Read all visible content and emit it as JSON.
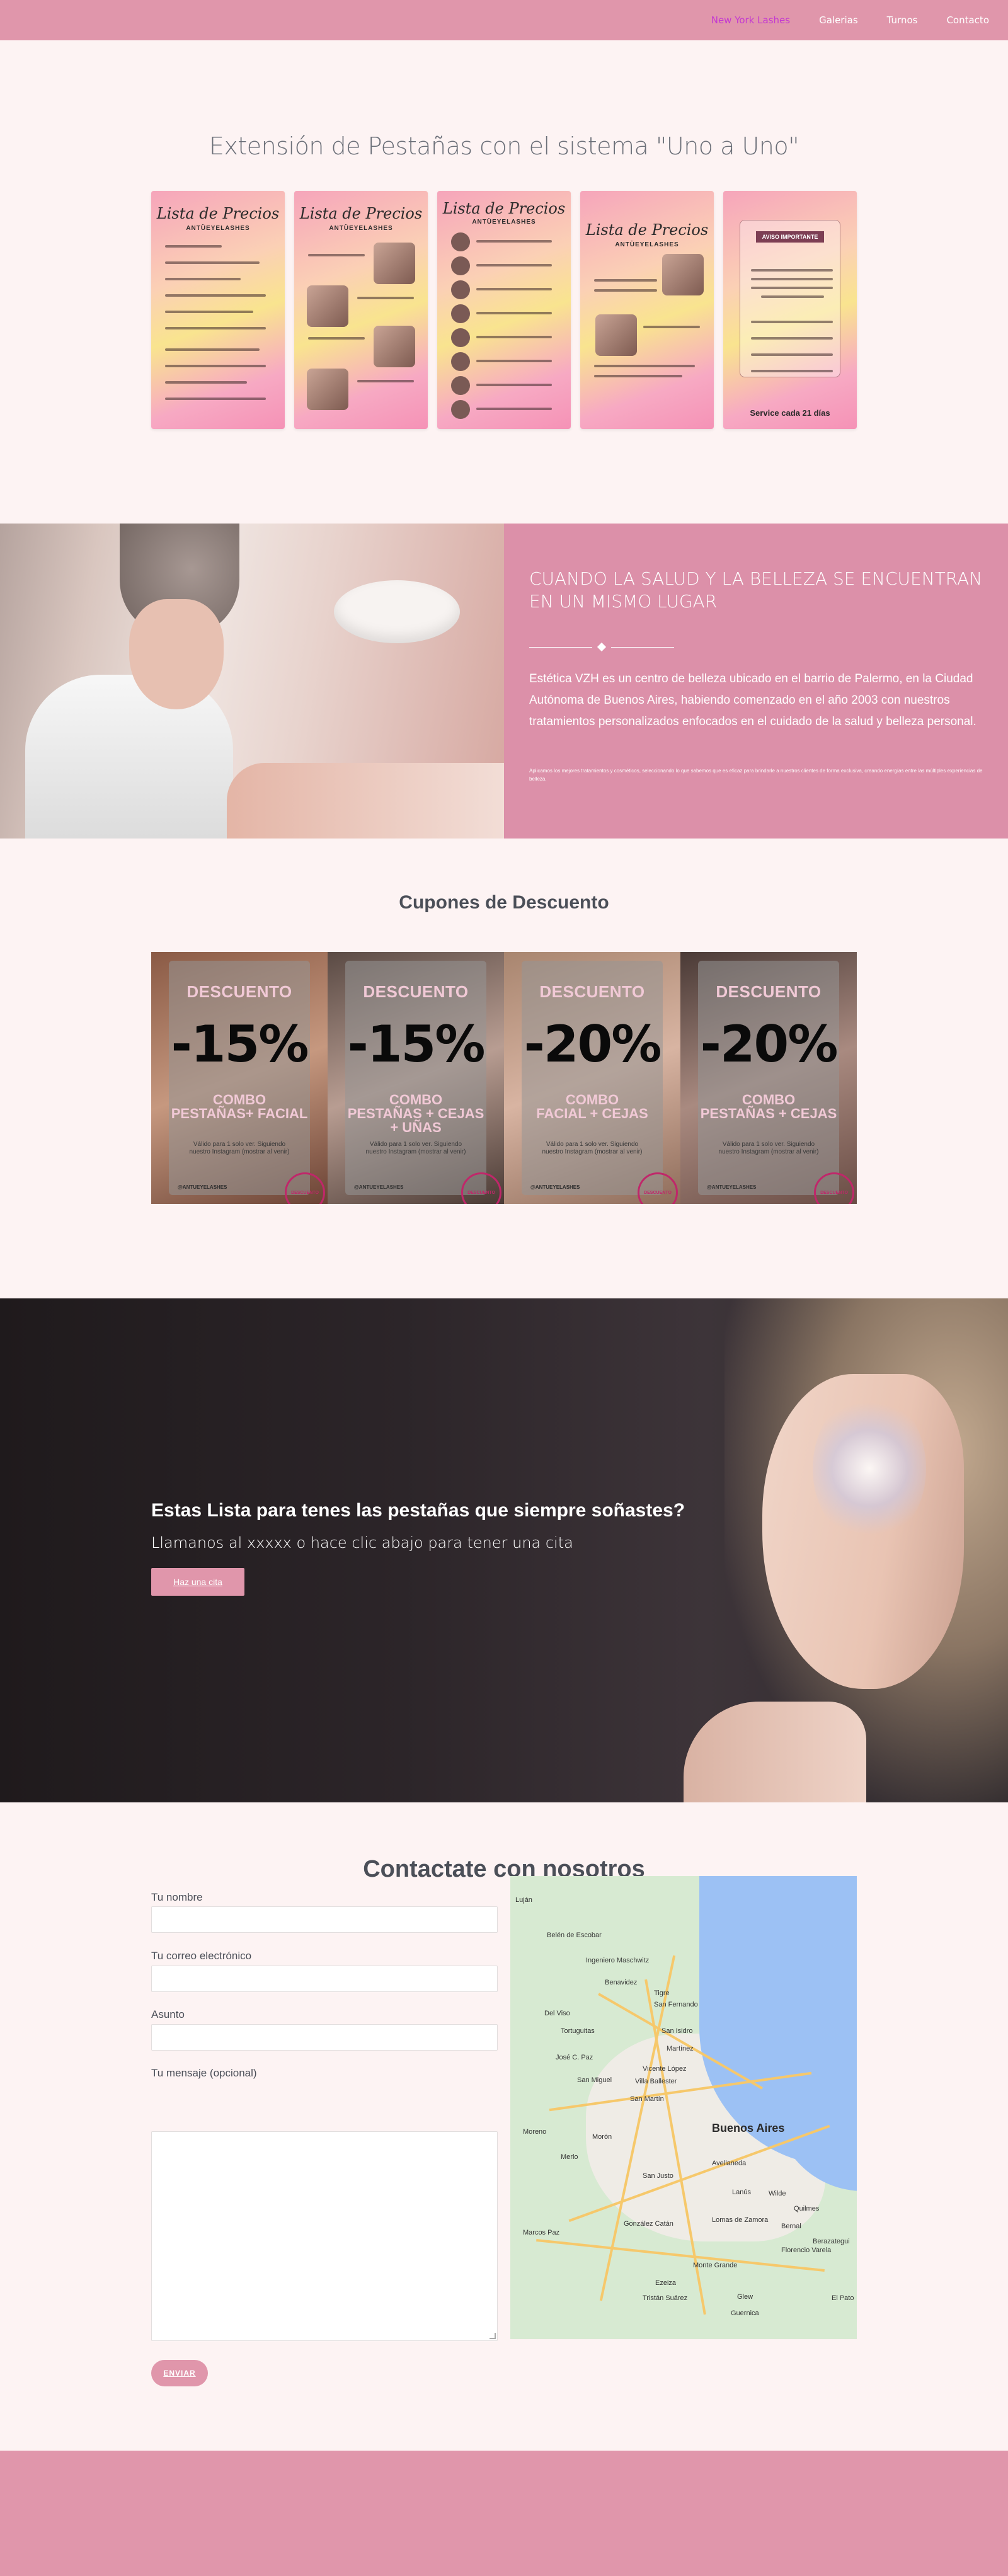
{
  "nav": {
    "items": [
      {
        "label": "New York Lashes",
        "active": true
      },
      {
        "label": "Galerias",
        "active": false
      },
      {
        "label": "Turnos",
        "active": false
      },
      {
        "label": "Contacto",
        "active": false
      }
    ]
  },
  "hero": {
    "title": "Extensión de Pestañas con el sistema \"Uno a Uno\"",
    "cards": [
      {
        "title": "Lista de Precios",
        "subtitle": "ANTÜEYELASHES",
        "footer": ""
      },
      {
        "title": "Lista de Precios",
        "subtitle": "ANTÜEYELASHES",
        "footer": ""
      },
      {
        "title": "Lista de Precios",
        "subtitle": "ANTÜEYELASHES",
        "footer": ""
      },
      {
        "title": "Lista de Precios",
        "subtitle": "ANTÜEYELASHES",
        "footer": ""
      },
      {
        "title": "AVISO IMPORTANTE",
        "subtitle": "",
        "footer": "Service cada 21 días"
      }
    ]
  },
  "about": {
    "heading": "CUANDO LA SALUD Y LA BELLEZA SE ENCUENTRAN EN UN MISMO LUGAR",
    "body": "Estética VZH es un centro de belleza ubicado en el barrio de Palermo, en la Ciudad Autónoma de Buenos Aires, habiendo comenzado en el año 2003 con nuestros tratamientos personalizados enfocados en el cuidado de la salud y belleza personal.",
    "small": "Aplicamos los mejores tratamientos y cosméticos, seleccionando lo que sabemos que es eficaz para brindarle a nuestros clientes de forma exclusiva, creando energías entre las múltiples experiencias de belleza."
  },
  "coupons": {
    "title": "Cupones de Descuento",
    "items": [
      {
        "label": "DESCUENTO",
        "percent": "-15%",
        "combo": "COMBO\nPESTAÑAS+ FACIAL",
        "valid": "Válido para 1 solo ver. Siguiendo\nnuestro Instagram (mostrar al venir)",
        "handle": "@ANTUEYELASHES",
        "seal": "DESCUENTO"
      },
      {
        "label": "DESCUENTO",
        "percent": "-15%",
        "combo": "COMBO\nPESTAÑAS + CEJAS\n+ UÑAS",
        "valid": "Válido para 1 solo ver. Siguiendo\nnuestro Instagram (mostrar al venir)",
        "handle": "@ANTUEYELASHES",
        "seal": "DESCUENTO"
      },
      {
        "label": "DESCUENTO",
        "percent": "-20%",
        "combo": "COMBO\nFACIAL + CEJAS",
        "valid": "Válido para 1 solo ver. Siguiendo\nnuestro Instagram (mostrar al venir)",
        "handle": "@ANTUEYELASHES",
        "seal": "DESCUENTO"
      },
      {
        "label": "DESCUENTO",
        "percent": "-20%",
        "combo": "COMBO\nPESTAÑAS + CEJAS",
        "valid": "Válido para 1 solo ver. Siguiendo\nnuestro Instagram (mostrar al venir)",
        "handle": "@ANTUEYELASHES",
        "seal": "DESCUENTO"
      }
    ]
  },
  "cta": {
    "heading": "Estas Lista para tenes las pestañas que siempre soñastes?",
    "text": "Llamanos al xxxxx o hace clic abajo para tener una cita",
    "button": "Haz una cita"
  },
  "contact": {
    "title": "Contactate con nosotros",
    "name_label": "Tu nombre",
    "email_label": "Tu correo electrónico",
    "subject_label": "Asunto",
    "message_label": "Tu mensaje (opcional)",
    "send": "ENVIAR"
  },
  "map": {
    "labels": [
      "Luján",
      "Belén de Escobar",
      "Ingeniero Maschwitz",
      "Benavidez",
      "Tigre",
      "San Fernando",
      "Del Viso",
      "Tortuguitas",
      "San Isidro",
      "Martínez",
      "José C. Paz",
      "Vicente López",
      "San Miguel",
      "Villa Ballester",
      "San Martín",
      "Buenos Aires",
      "Moreno",
      "Morón",
      "Avellaneda",
      "Merlo",
      "San Justo",
      "Lanús",
      "Wilde",
      "Quilmes",
      "Lomas de Zamora",
      "Bernal",
      "Marcos Paz",
      "González Catán",
      "Berazategui",
      "Florencio Varela",
      "Monte Grande",
      "Ezeiza",
      "Tristán Suárez",
      "Glew",
      "Guernica",
      "El Pato"
    ],
    "city": "Buenos Aires"
  }
}
